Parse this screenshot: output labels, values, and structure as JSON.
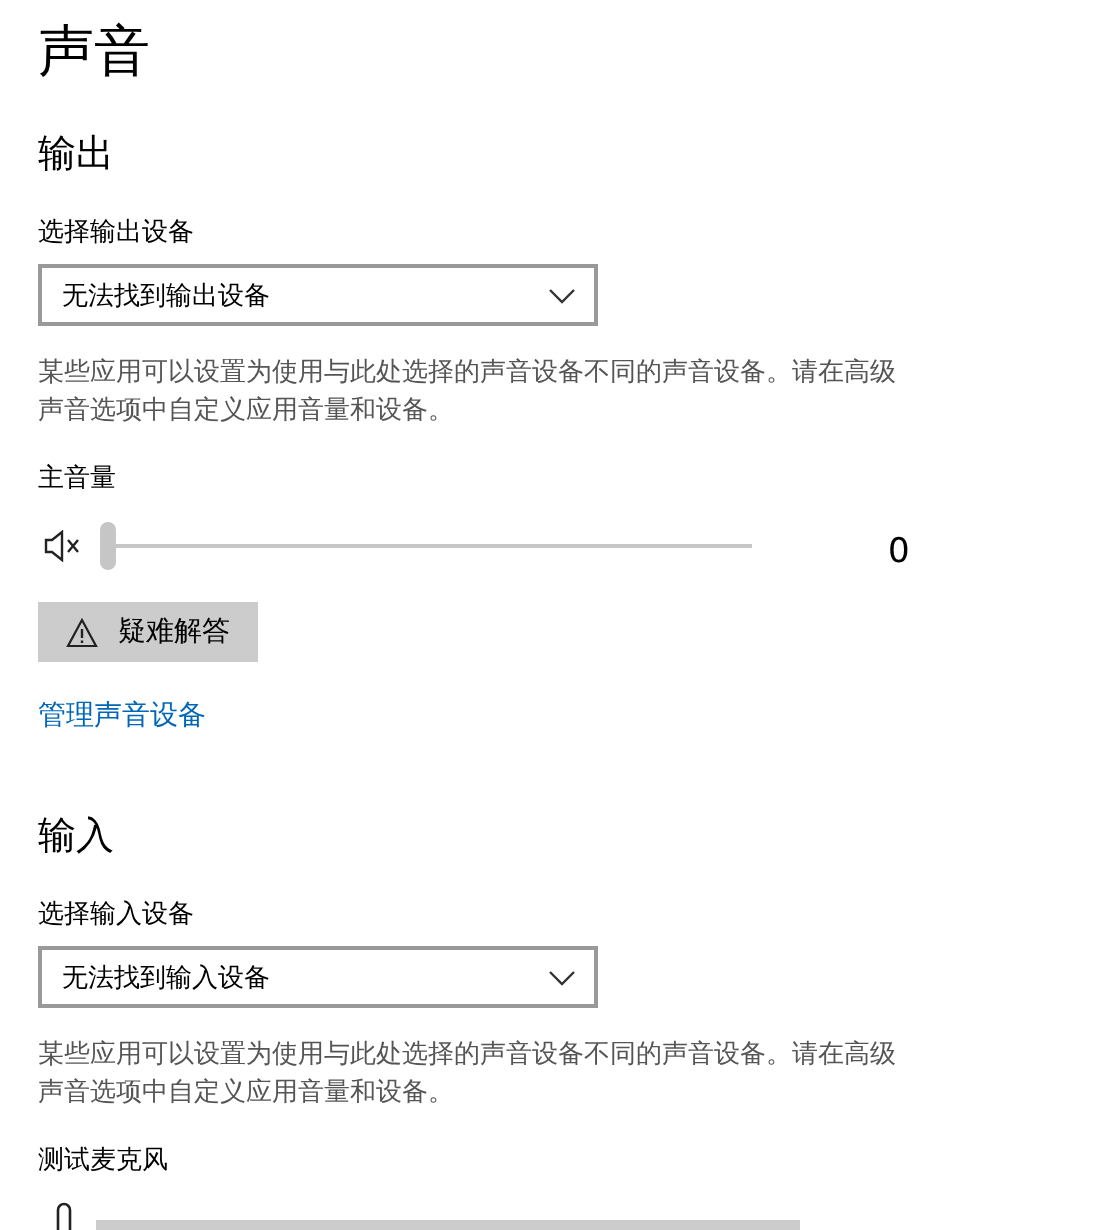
{
  "title": "声音",
  "output": {
    "heading": "输出",
    "device_label": "选择输出设备",
    "device_value": "无法找到输出设备",
    "description": "某些应用可以设置为使用与此处选择的声音设备不同的声音设备。请在高级声音选项中自定义应用音量和设备。",
    "volume_label": "主音量",
    "muted": true,
    "volume": {
      "level": 0,
      "reading": "0"
    },
    "troubleshoot_button": "疑难解答",
    "manage_link": "管理声音设备"
  },
  "input": {
    "heading": "输入",
    "device_label": "选择输入设备",
    "device_value": "无法找到输入设备",
    "description": "某些应用可以设置为使用与此处选择的声音设备不同的声音设备。请在高级声音选项中自定义应用音量和设备。",
    "test_label": "测试麦克风",
    "meter": {
      "level": 0
    }
  }
}
